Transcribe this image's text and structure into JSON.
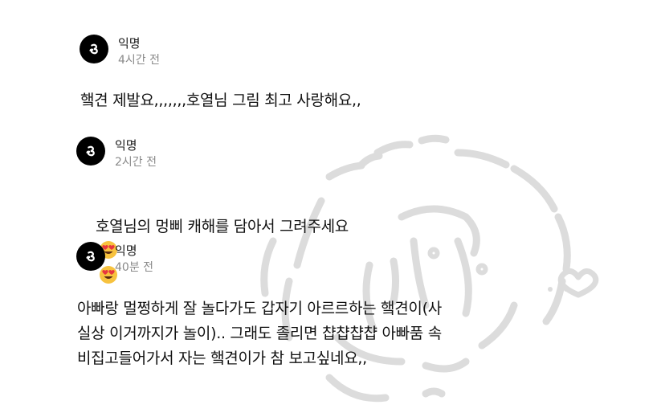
{
  "comments": [
    {
      "author": "익명",
      "time": "4시간 전",
      "text": "햌견 제발요,,,,,,,호열님 그림 최고 사랑해요,,"
    },
    {
      "author": "익명",
      "time": "2시간 전",
      "text": "호열님의 멍삐 캐해를 담아서 그려주세요",
      "emojis": [
        "heart-eyes-emoji",
        "heart-eyes-emoji"
      ]
    },
    {
      "author": "익명",
      "time": "40분 전",
      "lines": [
        "아빠랑 멀쩡하게 잘 놀다가도 갑자기 아르르하는 햌견이(사",
        "실상 이거까지가 놀이).. 그래도 졸리면 챱챱챱챱 아빠품 속",
        "비집고들어가서 자는 햌견이가 참 보고싶네요,,"
      ]
    }
  ],
  "colors": {
    "avatar_bg": "#000000",
    "time": "#8a8a8a",
    "watermark": "#dcdcdc"
  },
  "icons": {
    "avatar": "anonymous-logo-icon",
    "emoji": "heart-eyes-emoji"
  }
}
